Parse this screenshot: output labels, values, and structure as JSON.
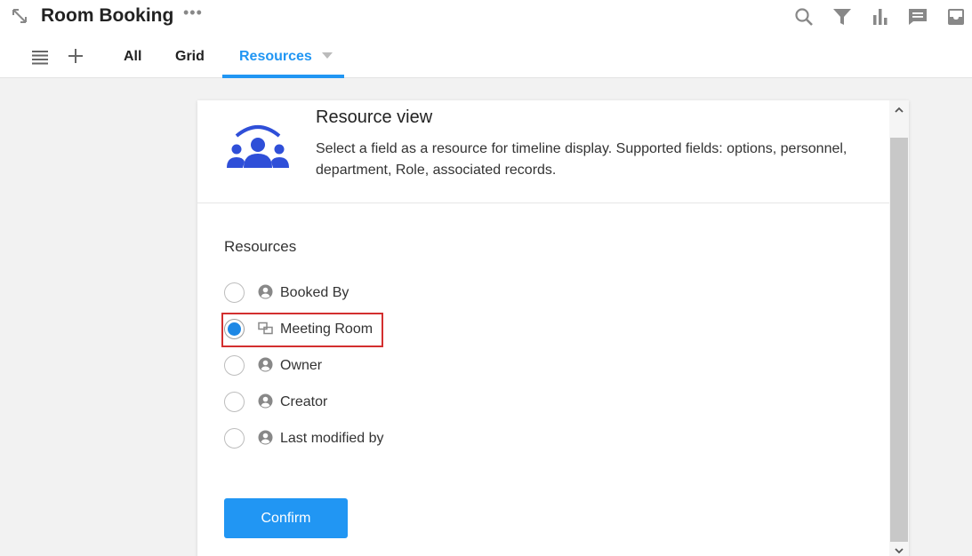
{
  "app": {
    "title": "Room Booking",
    "more_label": "•••",
    "expand_icon": "expand-arrows-icon",
    "toolbar_icons": [
      "search-icon",
      "filter-icon",
      "bar-chart-icon",
      "comment-icon",
      "inbox-icon"
    ]
  },
  "nav": {
    "menu_icon": "menu-icon",
    "add_icon": "plus-icon",
    "tabs": [
      {
        "label": "All",
        "active": false
      },
      {
        "label": "Grid",
        "active": false
      },
      {
        "label": "Resources",
        "active": true
      }
    ]
  },
  "panel": {
    "title": "Resource view",
    "description": "Select a field as a resource for timeline display. Supported fields: options, personnel, department, Role, associated records.",
    "section_label": "Resources",
    "options": [
      {
        "label": "Booked By",
        "icon": "person-circle-icon",
        "selected": false
      },
      {
        "label": "Meeting Room",
        "icon": "linked-record-icon",
        "selected": true
      },
      {
        "label": "Owner",
        "icon": "person-circle-icon",
        "selected": false
      },
      {
        "label": "Creator",
        "icon": "person-circle-icon",
        "selected": false
      },
      {
        "label": "Last modified by",
        "icon": "person-circle-icon",
        "selected": false
      }
    ],
    "confirm_label": "Confirm"
  },
  "colors": {
    "accent": "#2196f3",
    "highlight": "#d32f2f",
    "illustration": "#2f4fd8"
  }
}
